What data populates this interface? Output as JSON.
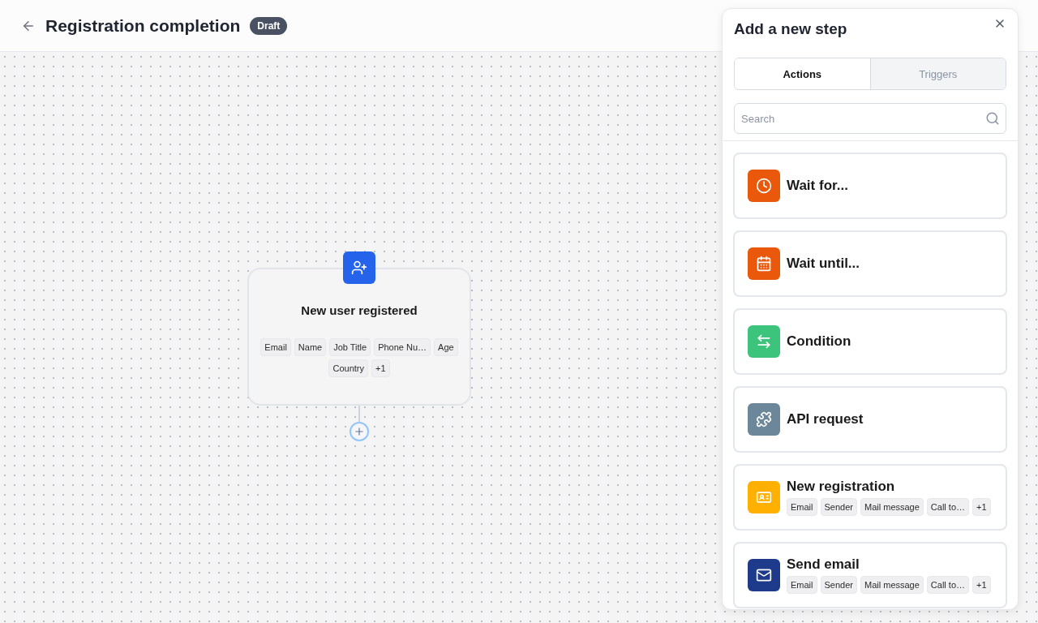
{
  "header": {
    "title": "Registration completion",
    "badge": "Draft"
  },
  "node": {
    "title": "New user registered",
    "tags": [
      "Email",
      "Name",
      "Job Title",
      "Phone Nu…",
      "Age",
      "Country",
      "+1"
    ]
  },
  "panel": {
    "title": "Add a new step",
    "tabs": [
      {
        "label": "Actions",
        "selected": true
      },
      {
        "label": "Triggers",
        "selected": false
      }
    ],
    "search": {
      "placeholder": "Search"
    },
    "steps": [
      {
        "label": "Wait for...",
        "kind": "clock",
        "color": "#ea580c"
      },
      {
        "label": "Wait until...",
        "kind": "calendar",
        "color": "#ea580c"
      },
      {
        "label": "Condition",
        "kind": "swap",
        "color": "#3cc47c"
      },
      {
        "label": "API request",
        "kind": "puzzle",
        "color": "#6b8799"
      },
      {
        "label": "New registration",
        "kind": "card",
        "color": "#ffb000",
        "tags": [
          "Email",
          "Sender",
          "Mail message",
          "Call to…",
          "+1"
        ]
      },
      {
        "label": "Send email",
        "kind": "mail",
        "color": "#1e3a8a",
        "tags": [
          "Email",
          "Sender",
          "Mail message",
          "Call to…",
          "+1"
        ]
      }
    ]
  }
}
